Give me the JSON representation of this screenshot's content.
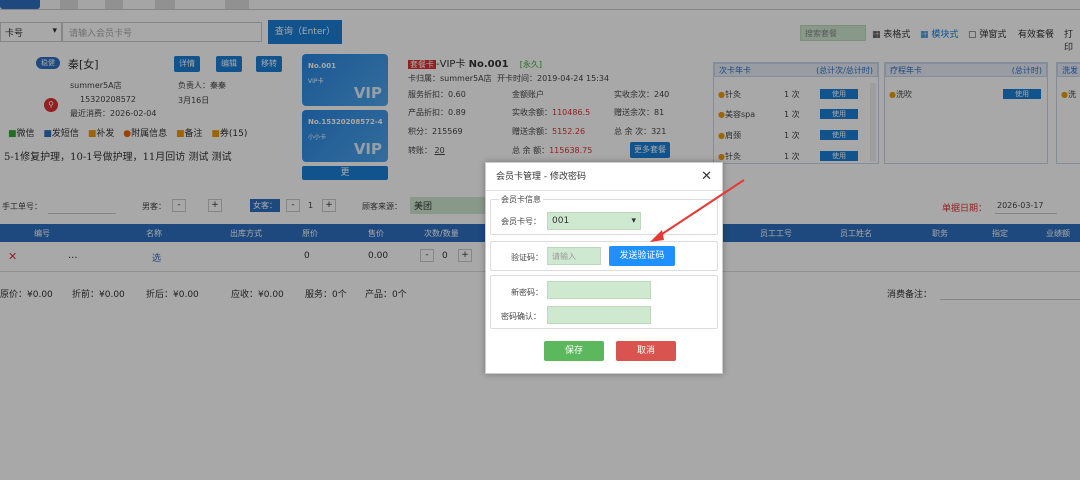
{
  "search": {
    "type_label": "卡号",
    "input_placeholder": "请输入会员卡号",
    "query_button": "查询（Enter）",
    "search_box_placeholder": "搜索套餐",
    "view_table": "表格式",
    "view_block": "模块式",
    "view_popup": "弹窗式",
    "valid_package": "有效套餐",
    "print": "打印"
  },
  "member": {
    "badge": "稳健",
    "name": "秦[女]",
    "store": "summer5A店",
    "phone": "15320208572",
    "last_visit": "最近消费：2026-02-04",
    "manager": "负责人：秦秦",
    "birthday": "3月16日",
    "btn_detail": "详情",
    "btn_edit": "编辑",
    "btn_move": "移转",
    "links": [
      "微信",
      "发短信",
      "补发",
      "附属信息",
      "备注",
      "券(15)"
    ],
    "note": "5-1修复护理，10-1号做护理，11月回访 测试 测试"
  },
  "cards": [
    {
      "no": "No.001",
      "type": "VIP卡",
      "vip": "VIP"
    },
    {
      "no": "No.15320208572-4",
      "type": "小小卡",
      "vip": "VIP"
    }
  ],
  "cards_more": "更",
  "card_info": {
    "tag": "套餐卡",
    "title_prefix": "-VIP卡",
    "title_no": "No.001",
    "status": "[永久]",
    "store": "卡归属：summer5A店",
    "open_time": "开卡时间：2019-04-24 15:34",
    "service_discount": "服务折扣：0.60",
    "product_discount": "产品折扣：0.89",
    "points": "积分：215569",
    "transfer": "转账：",
    "transfer_value": "20",
    "account_title": "金额账户",
    "real_balance_label": "实收余额：",
    "real_balance": "110486.5",
    "gift_balance_label": "赠送余额：",
    "gift_balance": "5152.26",
    "total_balance_label": "总 余 额：",
    "total_balance": "115638.75",
    "real_times": "实收余次：240",
    "gift_times": "赠送余次：81",
    "total_times": "总 余 次：321",
    "more_pkg": "更多套餐"
  },
  "panels": [
    {
      "title": "次卡年卡",
      "subtitle": "(总计次/总计时)",
      "items": [
        {
          "name": "针灸",
          "count": "1 次",
          "btn": "使用"
        },
        {
          "name": "美容spa",
          "count": "1 次",
          "btn": "使用"
        },
        {
          "name": "肩颈",
          "count": "1 次",
          "btn": "使用"
        },
        {
          "name": "针灸",
          "count": "1 次",
          "btn": "使用"
        }
      ]
    },
    {
      "title": "疗程年卡",
      "subtitle": "(总计时)",
      "items": [
        {
          "name": "洗吹",
          "count": "",
          "btn": "使用"
        }
      ]
    },
    {
      "title": "洗发",
      "subtitle": "",
      "items": [
        {
          "name": "洗",
          "count": "",
          "btn": ""
        }
      ]
    }
  ],
  "order": {
    "manual_no": "手工单号：",
    "male": "男客：",
    "male_count": "-",
    "female": "女客：",
    "female_count": "1",
    "source": "顾客来源：",
    "source_value": "美团",
    "date_label": "单据日期：",
    "date_value": "2026-03-17"
  },
  "table": {
    "columns": [
      "编号",
      "名称",
      "出库方式",
      "原价",
      "售价",
      "次数/数量",
      "员工工号",
      "员工姓名",
      "职务",
      "指定",
      "业绩额"
    ],
    "row": {
      "del": "✕",
      "dots": "...",
      "select": "选",
      "orig": "0",
      "price": "0.00",
      "qty": "0"
    }
  },
  "summary": {
    "orig": "原价：¥0.00",
    "before": "折前：¥0.00",
    "after": "折后：¥0.00",
    "due": "应收：¥0.00",
    "service": "服务：0个",
    "product": "产品：0个",
    "remark": "消费备注："
  },
  "modal": {
    "title": "会员卡管理 - 修改密码",
    "section": "会员卡信息",
    "card_label": "会员卡号：",
    "card_value": "001",
    "code_label": "验证码：",
    "code_placeholder": "请输入",
    "send_code": "发送验证码",
    "new_pwd": "新密码：",
    "confirm_pwd": "密码确认：",
    "save": "保存",
    "cancel": "取消"
  }
}
